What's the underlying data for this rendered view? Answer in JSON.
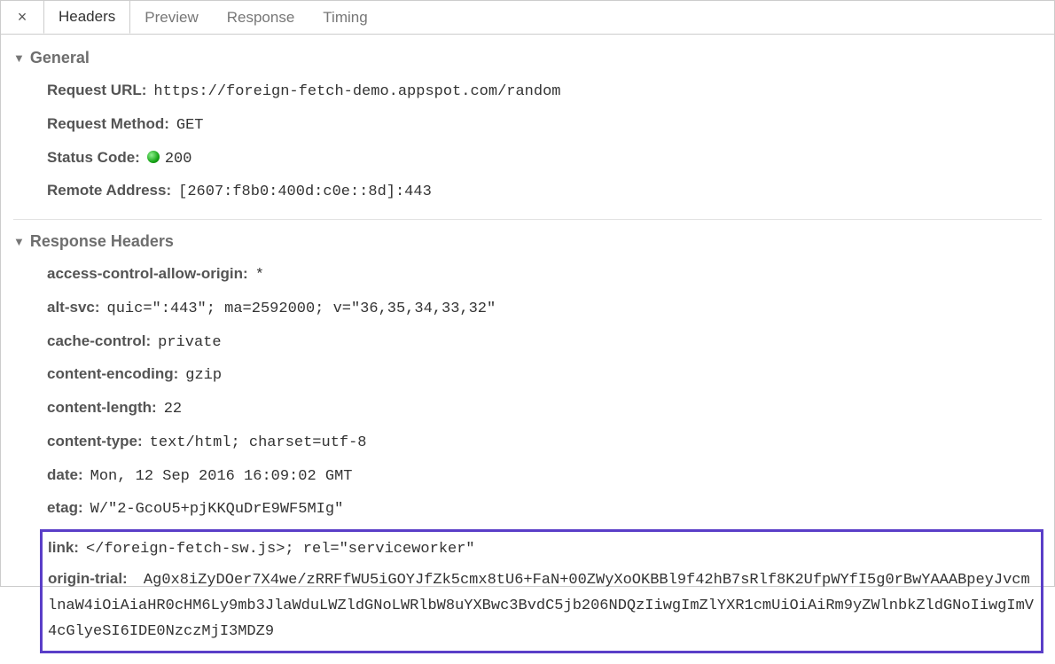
{
  "tabs": {
    "close_glyph": "×",
    "items": [
      "Headers",
      "Preview",
      "Response",
      "Timing"
    ],
    "active_index": 0
  },
  "sections": {
    "general": {
      "title": "General",
      "rows": [
        {
          "key": "Request URL:",
          "value": "https://foreign-fetch-demo.appspot.com/random",
          "mono": true
        },
        {
          "key": "Request Method:",
          "value": "GET",
          "mono": true
        },
        {
          "key": "Status Code:",
          "value": "200",
          "mono": true,
          "status_dot": true
        },
        {
          "key": "Remote Address:",
          "value": "[2607:f8b0:400d:c0e::8d]:443",
          "mono": true
        }
      ]
    },
    "response_headers": {
      "title": "Response Headers",
      "rows": [
        {
          "key": "access-control-allow-origin:",
          "value": "*",
          "mono": true
        },
        {
          "key": "alt-svc:",
          "value": "quic=\":443\"; ma=2592000; v=\"36,35,34,33,32\"",
          "mono": true
        },
        {
          "key": "cache-control:",
          "value": "private",
          "mono": true
        },
        {
          "key": "content-encoding:",
          "value": "gzip",
          "mono": true
        },
        {
          "key": "content-length:",
          "value": "22",
          "mono": true
        },
        {
          "key": "content-type:",
          "value": "text/html; charset=utf-8",
          "mono": true
        },
        {
          "key": "date:",
          "value": "Mon, 12 Sep 2016 16:09:02 GMT",
          "mono": true
        },
        {
          "key": "etag:",
          "value": "W/\"2-GcoU5+pjKKQuDrE9WF5MIg\"",
          "mono": true
        }
      ],
      "highlight": {
        "link": {
          "key": "link:",
          "value": "</foreign-fetch-sw.js>; rel=\"serviceworker\""
        },
        "origin_trial": {
          "key": "origin-trial:",
          "value": "Ag0x8iZyDOer7X4we/zRRFfWU5iGOYJfZk5cmx8tU6+FaN+00ZWyXoOKBBl9f42hB7sRlf8K2UfpWYfI5g0rBwYAAABpeyJvcmlnaW4iOiAiaHR0cHM6Ly9mb3JlaWduLWZldGNoLWRlbW8uYXBwc3BvdC5jb206NDQzIiwgImZlYXR1cmUiOiAiRm9yZWlnbkZldGNoIiwgImV4cGlyeSI6IDE0NzczMjI3MDZ9"
        }
      }
    }
  }
}
